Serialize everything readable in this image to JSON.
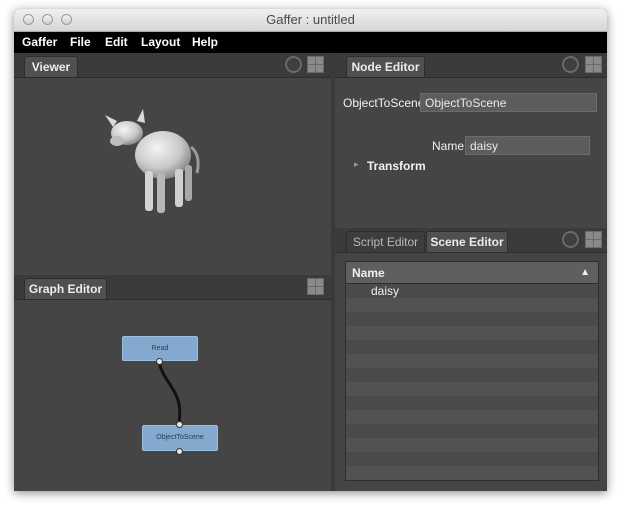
{
  "window": {
    "title": "Gaffer : untitled"
  },
  "menubar": [
    "Gaffer",
    "File",
    "Edit",
    "Layout",
    "Help"
  ],
  "viewer": {
    "tab": "Viewer"
  },
  "graph_editor": {
    "tab": "Graph Editor",
    "nodes": [
      {
        "label": "Read"
      },
      {
        "label": "ObjectToScene"
      }
    ]
  },
  "node_editor": {
    "tab": "Node Editor",
    "node_type": "ObjectToScene",
    "node_name_value": "ObjectToScene",
    "name_label": "Name",
    "name_value": "daisy",
    "transform_label": "Transform",
    "expand_glyph": "▸"
  },
  "bottom_right": {
    "tabs": [
      "Script Editor",
      "Scene Editor"
    ],
    "active_tab": "Scene Editor",
    "column_header": "Name",
    "sort_glyph": "▲",
    "rows": [
      "daisy"
    ]
  }
}
